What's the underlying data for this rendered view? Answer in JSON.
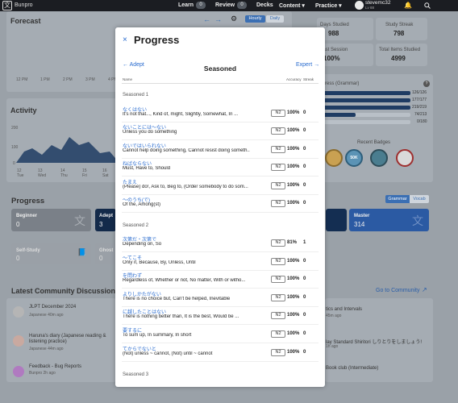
{
  "nav": {
    "brand": "Bunpro",
    "learn_label": "Learn",
    "learn_count": "0",
    "review_label": "Review",
    "review_count": "0",
    "decks_label": "Decks",
    "content_label": "Content ▾",
    "practice_label": "Practice ▾",
    "username": "stevemc32",
    "user_level": "Lv 88"
  },
  "forecast": {
    "title": "Forecast",
    "toggle_hourly": "Hourly",
    "toggle_daily": "Daily",
    "times": [
      "12 PM",
      "1 PM",
      "2 PM",
      "3 PM",
      "4 PM"
    ]
  },
  "activity": {
    "title": "Activity",
    "y_ticks": [
      "200",
      "100",
      "0"
    ],
    "x_ticks": [
      "12 Tue",
      "13 Wed",
      "14 Thu",
      "15 Fri",
      "16 Sat"
    ]
  },
  "stats": {
    "days_studied_label": "Days Studied",
    "days_studied": "988",
    "study_streak_label": "Study Streak",
    "study_streak": "798",
    "last_session_label": "Last Session",
    "last_session": "100%",
    "total_items_label": "Total Items Studied",
    "total_items": "4999",
    "progress_grammar_label": "ress (Grammar)",
    "levels": [
      "126/126",
      "177/177",
      "219/219",
      "74/213",
      "0/180"
    ],
    "recent_badges": "Recent Badges"
  },
  "progress_section": {
    "title": "Progress",
    "grammar_tab": "Grammar",
    "vocab_tab": "Vocab",
    "beginner_label": "Beginner",
    "beginner_value": "0",
    "adept_label": "Adept",
    "adept_value": "3",
    "master_label": "Master",
    "master_value": "314",
    "self_study_label": "Self-Study",
    "self_study_value": "0",
    "ghost_label": "Ghost",
    "ghost_value": "0"
  },
  "community": {
    "title": "Latest Community Discussions",
    "go_label": "Go to Community",
    "left": [
      {
        "title": "JLPT December 2024",
        "sub": "Japanese 40m ago"
      },
      {
        "title": "Haruna's diary (Japanese reading & listening practice)",
        "sub": "Japanese 44m ago"
      },
      {
        "title": "Feedback - Bug Reports",
        "sub": "Bunpro 2h ago"
      }
    ],
    "right": [
      {
        "title": "tics and Intervals",
        "sub": "45m ago"
      },
      {
        "title": "lay Standard Shiritori しりとりをしましょう!",
        "sub": "1h ago"
      },
      {
        "title": "Book club (Intermediate)",
        "sub": ""
      }
    ]
  },
  "modal": {
    "title": "Progress",
    "close_icon": "×",
    "prev_label": "Adept",
    "next_label": "Expert",
    "group_title": "Seasoned",
    "col_name": "Name",
    "col_accuracy": "Accuracy",
    "col_streak": "Streak",
    "sections": [
      {
        "label": "Seasoned 1",
        "items": [
          {
            "jp": "なくはない",
            "en": "It's not that..., Kind of, might, Slightly, Somewhat, In ...",
            "level": "N2",
            "accuracy": "100%",
            "streak": "0"
          },
          {
            "jp": "ないことには～ない",
            "en": "Unless you do something",
            "level": "N2",
            "accuracy": "100%",
            "streak": "0"
          },
          {
            "jp": "ないではいられない",
            "en": "Cannot help doing something, Cannot resist doing someth...",
            "level": "N2",
            "accuracy": "100%",
            "streak": "0"
          },
          {
            "jp": "ねばならない",
            "en": "Must, Have to, Should",
            "level": "N2",
            "accuracy": "100%",
            "streak": "0"
          },
          {
            "jp": "たまえ",
            "en": "(Please) do!, Ask to, Beg to, (Order somebody to do som...",
            "level": "N2",
            "accuracy": "100%",
            "streak": "0"
          },
          {
            "jp": "～のうち(で)",
            "en": "Of the, Among(st)",
            "level": "N2",
            "accuracy": "100%",
            "streak": "0"
          }
        ]
      },
      {
        "label": "Seasoned 2",
        "items": [
          {
            "jp": "次第だ・次第で",
            "en": "Depending on, So",
            "level": "N2",
            "accuracy": "81%",
            "streak": "1"
          },
          {
            "jp": "～てこそ",
            "en": "Only if, Because, By, Unless, Until",
            "level": "N2",
            "accuracy": "100%",
            "streak": "0"
          },
          {
            "jp": "を問わず",
            "en": "Regardless of, Whether or not, No matter, With or witho...",
            "level": "N2",
            "accuracy": "100%",
            "streak": "0"
          },
          {
            "jp": "よりしかたがない",
            "en": "There is no choice but, Can't be helped, Inevitable",
            "level": "N2",
            "accuracy": "100%",
            "streak": "0"
          },
          {
            "jp": "に越したことはない",
            "en": "There is nothing better than, It is the best, Would be ...",
            "level": "N2",
            "accuracy": "100%",
            "streak": "0"
          },
          {
            "jp": "要するに",
            "en": "To sum up, In summary, In short",
            "level": "N2",
            "accuracy": "100%",
            "streak": "0"
          },
          {
            "jp": "てからでないと",
            "en": "(Not) unless ~ cannot, (Not) until ~ cannot",
            "level": "N2",
            "accuracy": "100%",
            "streak": "0"
          }
        ]
      },
      {
        "label": "Seasoned 3",
        "items": []
      }
    ]
  }
}
